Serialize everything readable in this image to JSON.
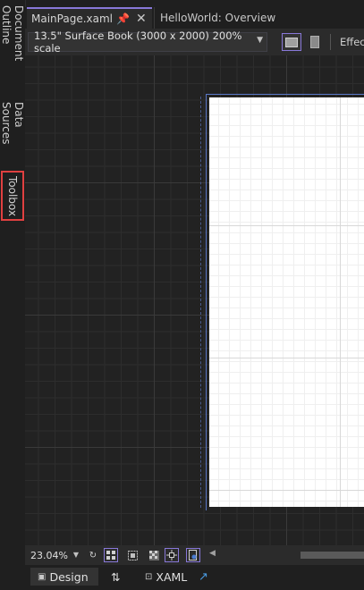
{
  "sidebar": {
    "tabs": [
      {
        "label": "Document Outline"
      },
      {
        "label": "Data Sources"
      },
      {
        "label": "Toolbox"
      }
    ]
  },
  "tabs": [
    {
      "label": "MainPage.xaml"
    },
    {
      "label": "HelloWorld: Overview"
    }
  ],
  "toolbar": {
    "device": "13.5\" Surface Book (3000 x 2000) 200% scale",
    "effects_label": "Effec"
  },
  "status": {
    "zoom": "23.04%"
  },
  "split": {
    "design_label": "Design",
    "swap_label": "⇅",
    "xaml_label": "XAML"
  },
  "colors": {
    "accent": "#8878d8",
    "highlight": "#e04040",
    "ruler": "#5a78c8"
  }
}
